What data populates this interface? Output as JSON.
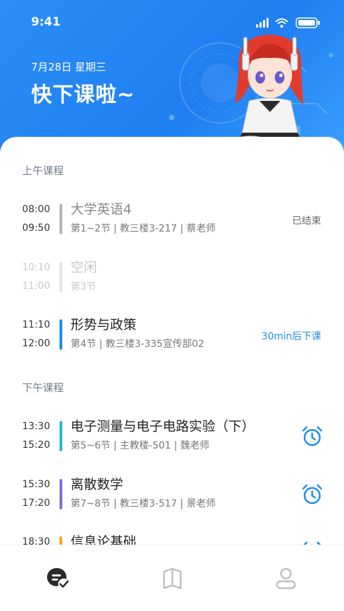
{
  "status_bar": {
    "time": "9:41"
  },
  "header": {
    "date": "7月28日 星期三",
    "greeting": "快下课啦~"
  },
  "sections": {
    "morning": "上午课程",
    "afternoon": "下午课程"
  },
  "classes": [
    {
      "start": "08:00",
      "end": "09:50",
      "name": "大学英语4",
      "detail": "第1~2节 | 教三楼3-217 | 蔡老师",
      "status": "已结束",
      "color": "#b5b5b5"
    },
    {
      "start": "10:10",
      "end": "11:00",
      "name": "空闲",
      "detail": "第3节",
      "color": "#e3e3e3"
    },
    {
      "start": "11:10",
      "end": "12:00",
      "name": "形势与政策",
      "detail": "第4节 | 教三楼3-335宣传部02",
      "status": "30min后下课",
      "color": "#1a8df0"
    },
    {
      "start": "13:30",
      "end": "15:20",
      "name": "电子测量与电子电路实验（下）",
      "detail": "第5~6节 | 主教楼-501 | 魏老师",
      "color": "#27b9c9"
    },
    {
      "start": "15:30",
      "end": "17:20",
      "name": "离散数学",
      "detail": "第7~8节 | 教三楼3-517 | 景老师",
      "color": "#7b6fe0"
    },
    {
      "start": "18:30",
      "end": "",
      "name": "信息论基础",
      "detail": "",
      "color": "#f5a623"
    }
  ],
  "colors": {
    "accent": "#1a8df0",
    "header": "#2386f4"
  },
  "tabbar": {
    "icons": [
      "schedule-icon",
      "book-icon",
      "profile-icon"
    ]
  }
}
